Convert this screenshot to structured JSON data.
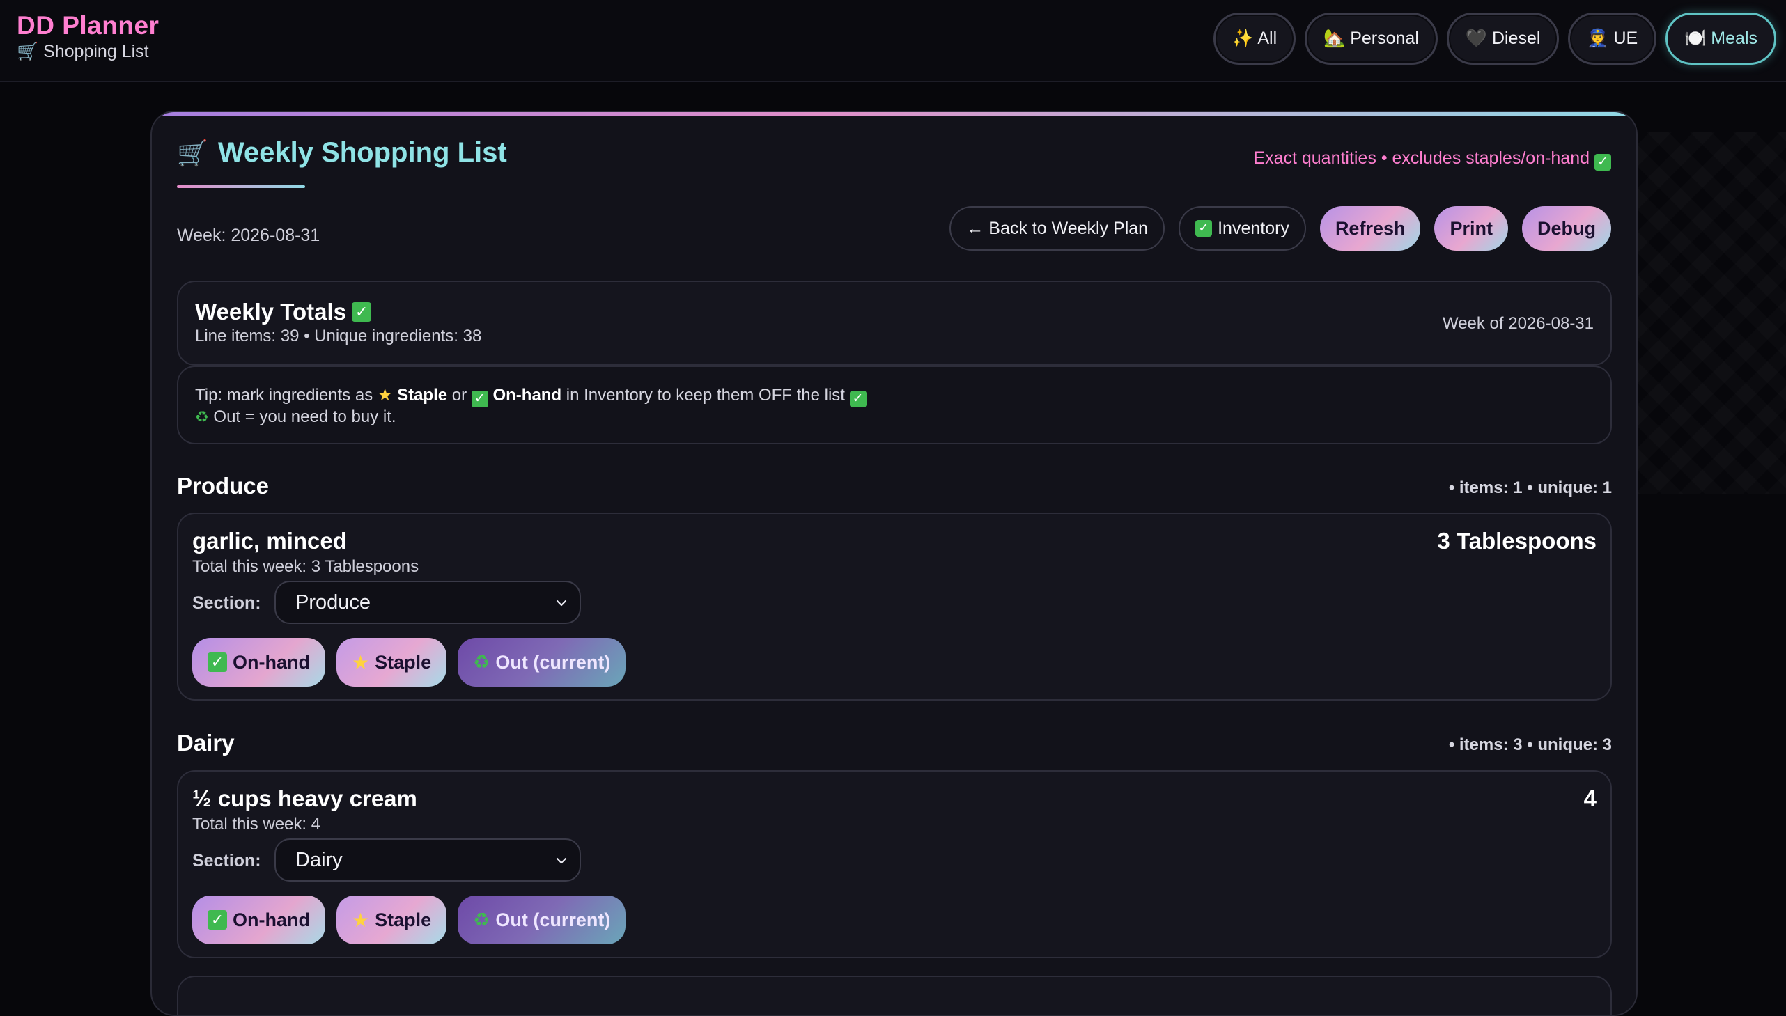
{
  "app": {
    "title": "DD Planner",
    "subtitle": "🛒 Shopping List"
  },
  "nav": [
    {
      "label": "✨ All"
    },
    {
      "label": "🏡 Personal"
    },
    {
      "label": "🖤 Diesel"
    },
    {
      "label": "👮 UE"
    },
    {
      "label": "🍽️ Meals",
      "active": true
    }
  ],
  "page": {
    "title": "Weekly Shopping List",
    "subnote": "Exact quantities • excludes staples/on-hand",
    "week": "Week: 2026-08-31"
  },
  "actions": {
    "back": "← Back to Weekly Plan",
    "inventory": "Inventory",
    "refresh": "Refresh",
    "print": "Print",
    "debug": "Debug"
  },
  "totals": {
    "title": "Weekly Totals",
    "meta": "Line items: 39 • Unique ingredients: 38",
    "week_of": "Week of 2026-08-31"
  },
  "tip": {
    "pre": "Tip: mark ingredients as ",
    "staple": "Staple",
    "or": " or ",
    "onhand": "On-hand",
    "post": " in Inventory to keep them OFF the list",
    "line2": "Out = you need to buy it."
  },
  "section_label": "Section:",
  "chips": {
    "onhand": "On-hand",
    "staple": "Staple",
    "out": "Out (current)"
  },
  "sections": [
    {
      "name": "Produce",
      "stats": "• items: 1 • unique: 1",
      "items": [
        {
          "name": "garlic, minced",
          "qty": "3 Tablespoons",
          "total": "Total this week: 3 Tablespoons",
          "section": "Produce"
        }
      ]
    },
    {
      "name": "Dairy",
      "stats": "• items: 3 • unique: 3",
      "items": [
        {
          "name": "½ cups heavy cream",
          "qty": "4",
          "total": "Total this week: 4",
          "section": "Dairy"
        }
      ]
    }
  ],
  "colors": {
    "brand": "#ff7fd0",
    "accent": "#8fe3e6",
    "background": "#07070b",
    "card": "#12121a",
    "check": "#3fb950"
  }
}
